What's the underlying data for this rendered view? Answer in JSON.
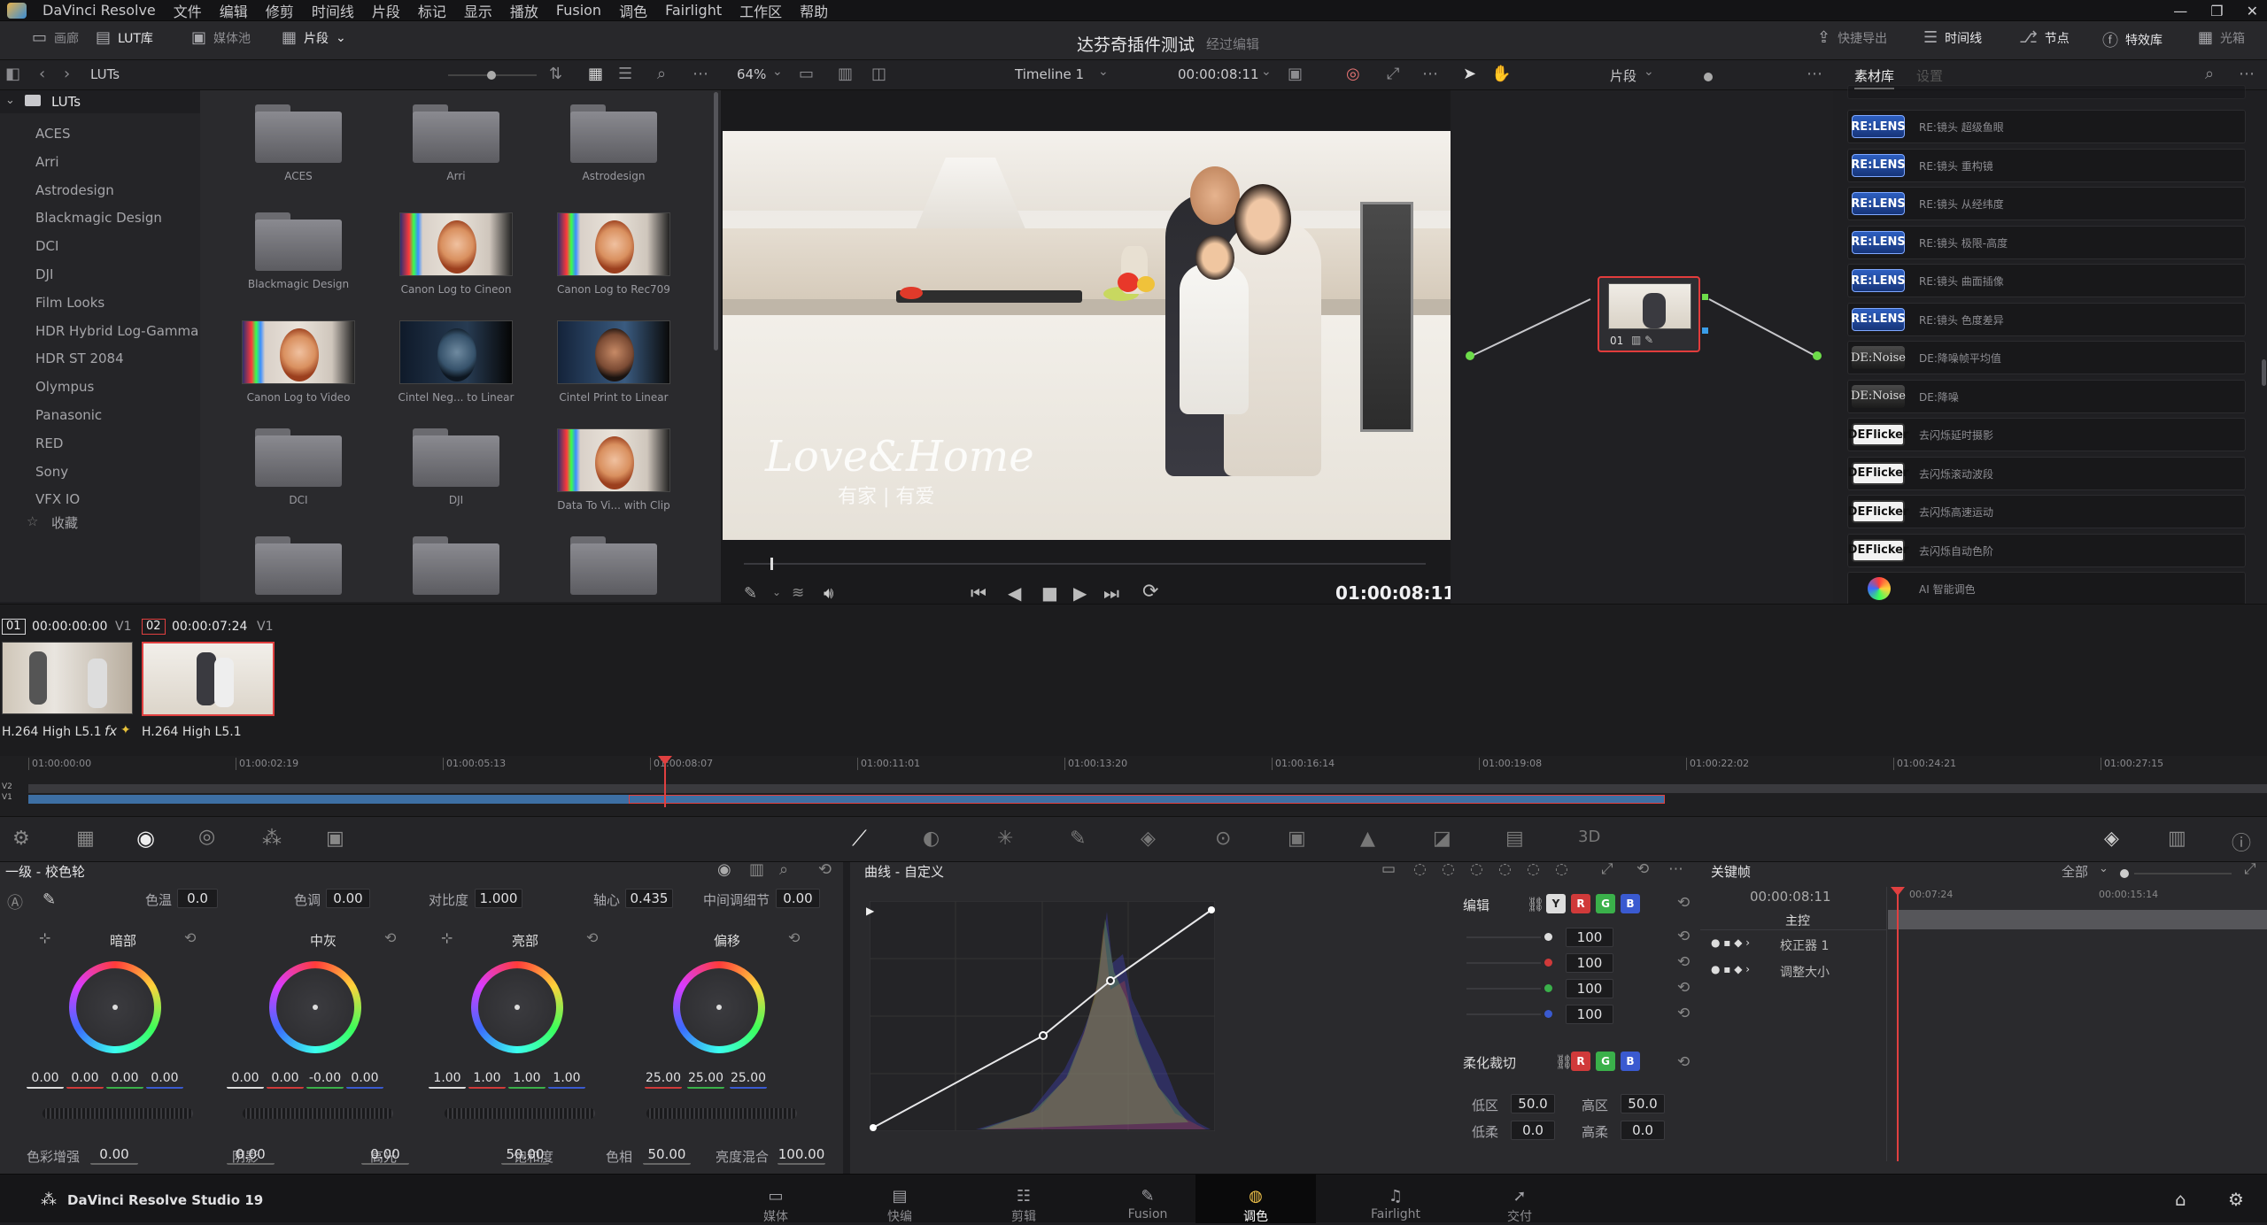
{
  "menu": {
    "app": "DaVinci Resolve",
    "items": [
      "文件",
      "编辑",
      "修剪",
      "时间线",
      "片段",
      "标记",
      "显示",
      "播放",
      "Fusion",
      "调色",
      "Fairlight",
      "工作区",
      "帮助"
    ]
  },
  "toolbar": {
    "gallery": "画廊",
    "lut": "LUT库",
    "media": "媒体池",
    "clips": "片段",
    "title": "达芬奇插件测试",
    "subtitle": "经过编辑",
    "quick_export": "快捷导出",
    "timeline": "时间线",
    "nodes": "节点",
    "effects": "特效库",
    "lightbox": "光箱"
  },
  "subbar": {
    "luts": "LUTs",
    "zoom": "64%",
    "timeline_name": "Timeline 1",
    "timecode": "00:00:08:11",
    "clip_mode": "片段",
    "fx_tab1": "素材库",
    "fx_tab2": "设置"
  },
  "lut_tree": {
    "root": "LUTs",
    "items": [
      "ACES",
      "Arri",
      "Astrodesign",
      "Blackmagic Design",
      "DCI",
      "DJI",
      "Film Looks",
      "HDR Hybrid Log-Gamma",
      "HDR ST 2084",
      "Olympus",
      "Panasonic",
      "RED",
      "Sony",
      "VFX IO"
    ],
    "favorites": "收藏"
  },
  "lut_grid": [
    {
      "label": "ACES",
      "kind": "folder"
    },
    {
      "label": "Arri",
      "kind": "folder"
    },
    {
      "label": "Astrodesign",
      "kind": "folder"
    },
    {
      "label": "Blackmagic Design",
      "kind": "folder"
    },
    {
      "label": "Canon Log to Cineon",
      "kind": "face"
    },
    {
      "label": "Canon Log to Rec709",
      "kind": "face"
    },
    {
      "label": "Canon Log to Video",
      "kind": "face"
    },
    {
      "label": "Cintel Neg... to Linear",
      "kind": "dark"
    },
    {
      "label": "Cintel Print to Linear",
      "kind": "dk2"
    },
    {
      "label": "DCI",
      "kind": "folder"
    },
    {
      "label": "DJI",
      "kind": "folder"
    },
    {
      "label": "Data To Vi... with Clip",
      "kind": "face"
    },
    {
      "label": "",
      "kind": "folder"
    },
    {
      "label": "",
      "kind": "folder"
    },
    {
      "label": "",
      "kind": "folder"
    }
  ],
  "viewer": {
    "watermark": "Love&Home",
    "watermark_sub": "有家 | 有爱",
    "timecode": "01:00:08:11",
    "node_label": "01"
  },
  "effects": [
    {
      "badge": "RE:LENS",
      "name": "RE:镜头 超级鱼眼",
      "style": "relens"
    },
    {
      "badge": "RE:LENS",
      "name": "RE:镜头 重构镜",
      "style": "relens"
    },
    {
      "badge": "RE:LENS",
      "name": "RE:镜头 从经纬度",
      "style": "relens"
    },
    {
      "badge": "RE:LENS",
      "name": "RE:镜头 极限-高度",
      "style": "relens"
    },
    {
      "badge": "RE:LENS",
      "name": "RE:镜头 曲面插像",
      "style": "relens"
    },
    {
      "badge": "RE:LENS",
      "name": "RE:镜头 色度差异",
      "style": "relens"
    },
    {
      "badge": "DE:Noise",
      "name": "DE:降噪帧平均值",
      "style": "denoise"
    },
    {
      "badge": "DE:Noise",
      "name": "DE:降噪",
      "style": "denoise"
    },
    {
      "badge": "DEFlicker",
      "name": "去闪烁延时摄影",
      "style": "deflicker"
    },
    {
      "badge": "DEFlicker",
      "name": "去闪烁滚动波段",
      "style": "deflicker"
    },
    {
      "badge": "DEFlicker",
      "name": "去闪烁高速运动",
      "style": "deflicker"
    },
    {
      "badge": "DEFlicker",
      "name": "去闪烁自动色阶",
      "style": "deflicker"
    },
    {
      "badge": "",
      "name": "AI 智能调色",
      "style": "ai"
    }
  ],
  "clips": [
    {
      "num": "01",
      "tc": "00:00:00:00",
      "track": "V1",
      "codec": "H.264 High L5.1"
    },
    {
      "num": "02",
      "tc": "00:00:07:24",
      "track": "V1",
      "codec": "H.264 High L5.1"
    }
  ],
  "timeline": {
    "ticks": [
      "01:00:00:00",
      "01:00:02:19",
      "01:00:05:13",
      "01:00:08:07",
      "01:00:11:01",
      "01:00:13:20",
      "01:00:16:14",
      "01:00:19:08",
      "01:00:22:02",
      "01:00:24:21",
      "01:00:27:15"
    ],
    "tracks": [
      "V2",
      "V1"
    ]
  },
  "primaries": {
    "title": "一级 - 校色轮",
    "temp_label": "色温",
    "temp": "0.0",
    "tint_label": "色调",
    "tint": "0.00",
    "contrast_label": "对比度",
    "contrast": "1.000",
    "pivot_label": "轴心",
    "pivot": "0.435",
    "middetail_label": "中间调细节",
    "middetail": "0.00",
    "wheels": [
      {
        "name": "暗部",
        "values": [
          "0.00",
          "0.00",
          "0.00",
          "0.00"
        ]
      },
      {
        "name": "中灰",
        "values": [
          "0.00",
          "0.00",
          "-0.00",
          "0.00"
        ]
      },
      {
        "name": "亮部",
        "values": [
          "1.00",
          "1.00",
          "1.00",
          "1.00"
        ]
      },
      {
        "name": "偏移",
        "values": [
          "25.00",
          "25.00",
          "25.00"
        ]
      }
    ],
    "bottom": [
      {
        "label": "色彩增强",
        "value": "0.00"
      },
      {
        "label": "阴影",
        "value": "0.00"
      },
      {
        "label": "高光",
        "value": "0.00"
      },
      {
        "label": "饱和度",
        "value": "50.00"
      },
      {
        "label": "色相",
        "value": "50.00"
      },
      {
        "label": "亮度混合",
        "value": "100.00"
      }
    ]
  },
  "curves": {
    "title": "曲线 - 自定义",
    "edit_label": "编辑",
    "channel_values": [
      "100",
      "100",
      "100",
      "100"
    ],
    "soft_clip": "柔化裁切",
    "low_label": "低区",
    "low": "50.0",
    "high_label": "高区",
    "high": "50.0",
    "lowsoft_label": "低柔",
    "lowsoft": "0.0",
    "highsoft_label": "高柔",
    "highsoft": "0.0",
    "chips": [
      "Y",
      "R",
      "G",
      "B"
    ]
  },
  "keyframes": {
    "title": "关键帧",
    "filter": "全部",
    "timecode": "00:00:08:11",
    "t1": "00:07:24",
    "t2": "00:00:15:14",
    "master": "主控",
    "rows": [
      "校正器 1",
      "调整大小"
    ]
  },
  "footer": {
    "brand": "DaVinci Resolve Studio 19",
    "pages": [
      "媒体",
      "快编",
      "剪辑",
      "Fusion",
      "调色",
      "Fairlight",
      "交付"
    ],
    "active": "调色"
  }
}
